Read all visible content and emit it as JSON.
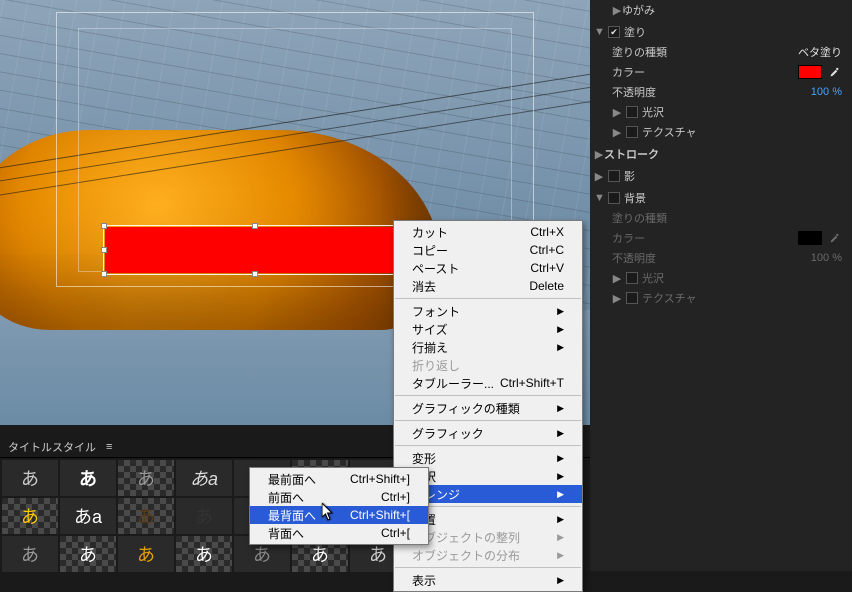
{
  "props": {
    "distort_row": {
      "label": "ゆがみ"
    },
    "fill": {
      "section_label": "塗り",
      "type_label": "塗りの種類",
      "type_value": "ベタ塗り",
      "color_label": "カラー",
      "color_value": "#ff0000",
      "opacity_label": "不透明度",
      "opacity_value": "100 %",
      "sheen_label": "光沢",
      "texture_label": "テクスチャ"
    },
    "stroke": {
      "section_label": "ストローク"
    },
    "shadow": {
      "section_label": "影"
    },
    "bg": {
      "section_label": "背景",
      "type_label": "塗りの種類",
      "color_label": "カラー",
      "color_value": "#000000",
      "opacity_label": "不透明度",
      "opacity_value": "100 %",
      "sheen_label": "光沢",
      "texture_label": "テクスチャ"
    }
  },
  "title_styles": {
    "header": "タイトルスタイル",
    "menu_glyph": "≡"
  },
  "menus": {
    "main": {
      "items": [
        {
          "label": "カット",
          "accel": "Ctrl+X"
        },
        {
          "label": "コピー",
          "accel": "Ctrl+C"
        },
        {
          "label": "ペースト",
          "accel": "Ctrl+V"
        },
        {
          "label": "消去",
          "accel": "Delete"
        }
      ],
      "group2": [
        {
          "label": "フォント",
          "sub": true
        },
        {
          "label": "サイズ",
          "sub": true
        },
        {
          "label": "行揃え",
          "sub": true
        },
        {
          "label": "折り返し",
          "dim": true
        },
        {
          "label": "タブルーラー...",
          "accel": "Ctrl+Shift+T"
        }
      ],
      "group3": [
        {
          "label": "グラフィックの種類",
          "sub": true
        }
      ],
      "group4": [
        {
          "label": "グラフィック",
          "sub": true
        }
      ],
      "group5": [
        {
          "label": "変形",
          "sub": true
        },
        {
          "label": "選択",
          "sub": true
        },
        {
          "label": "アレンジ",
          "sub": true,
          "hl": true
        }
      ],
      "group6": [
        {
          "label": "位置",
          "sub": true
        },
        {
          "label": "オブジェクトの整列",
          "sub": true,
          "dim": true
        },
        {
          "label": "オブジェクトの分布",
          "sub": true,
          "dim": true
        }
      ],
      "group7": [
        {
          "label": "表示",
          "sub": true
        }
      ]
    },
    "arrange": {
      "items": [
        {
          "label": "最前面へ",
          "accel": "Ctrl+Shift+]"
        },
        {
          "label": "前面へ",
          "accel": "Ctrl+]"
        },
        {
          "label": "最背面へ",
          "accel": "Ctrl+Shift+[",
          "hl": true
        },
        {
          "label": "背面へ",
          "accel": "Ctrl+["
        }
      ]
    }
  }
}
